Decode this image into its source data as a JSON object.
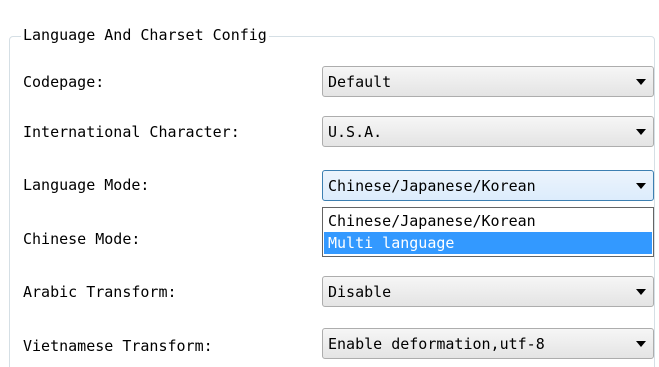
{
  "group": {
    "title": "Language And Charset Config"
  },
  "fields": [
    {
      "label": "Codepage:",
      "value": "Default"
    },
    {
      "label": "International Character:",
      "value": "U.S.A."
    },
    {
      "label": "Language Mode:",
      "value": "Chinese/Japanese/Korean"
    },
    {
      "label": "Chinese Mode:",
      "value": ""
    },
    {
      "label": "Arabic Transform:",
      "value": "Disable"
    },
    {
      "label": "Vietnamese Transform:",
      "value": "Enable deformation,utf-8"
    }
  ],
  "language_mode_dropdown": {
    "options": [
      "Chinese/Japanese/Korean",
      "Multi language"
    ],
    "highlighted": "Multi language"
  },
  "colors": {
    "selection": "#3399ff",
    "focus_border": "#3c7fb1",
    "group_border": "#d5dfe5"
  },
  "icons": {
    "combo_arrow": "chevron-down-icon"
  }
}
